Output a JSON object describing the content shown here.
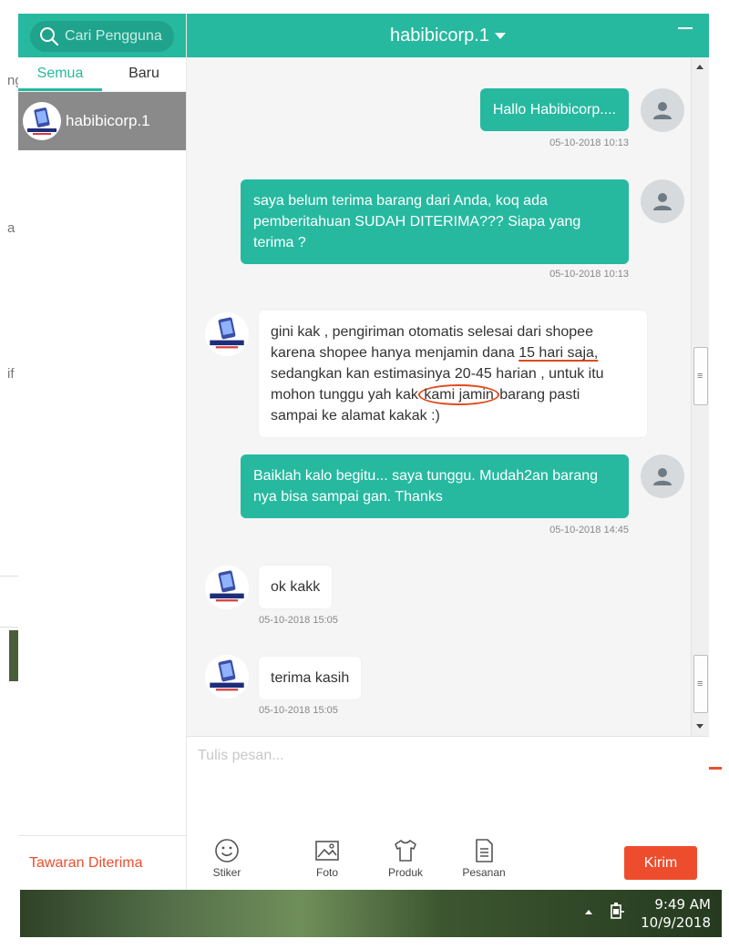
{
  "background_window": {
    "fragments": [
      "ng",
      "a",
      "if"
    ]
  },
  "sidebar": {
    "search_placeholder": "Cari Pengguna",
    "tabs": [
      {
        "label": "Semua",
        "active": true
      },
      {
        "label": "Baru",
        "active": false
      }
    ],
    "conversations": [
      {
        "name": "habibicorp.1",
        "avatar_text": "SMARTPHONE"
      }
    ],
    "footer_link": "Tawaran Diterima"
  },
  "chat": {
    "title": "habibicorp.1",
    "messages": [
      {
        "direction": "out",
        "text": "Hallo Habibicorp....",
        "time": "05-10-2018 10:13"
      },
      {
        "direction": "out",
        "text": "saya belum terima barang dari Anda, koq ada pemberitahuan SUDAH DITERIMA??? Siapa yang terima ?",
        "time": "05-10-2018 10:13"
      },
      {
        "direction": "in",
        "lines": [
          "gini kak , pengiriman otomatis selesai dari shopee",
          "karena shopee hanya menjamin dana ",
          "15 hari saja,",
          "sedangkan kan estimasinya 20-45 harian , untuk itu",
          "mohon tunggu yah kak ",
          "kami jamin",
          " barang pasti",
          "sampai ke alamat kakak :)"
        ],
        "time": ""
      },
      {
        "direction": "out",
        "text": "Baiklah kalo begitu... saya tunggu. Mudah2an barang nya bisa sampai gan. Thanks",
        "time": "05-10-2018 14:45"
      },
      {
        "direction": "in",
        "text": "ok kakk",
        "time": "05-10-2018 15:05"
      },
      {
        "direction": "in",
        "text": "terima kasih",
        "time": "05-10-2018 15:05"
      }
    ]
  },
  "composer": {
    "placeholder": "Tulis pesan...",
    "tools": [
      {
        "label": "Stiker",
        "icon": "smiley-icon"
      },
      {
        "label": "Foto",
        "icon": "image-icon"
      },
      {
        "label": "Produk",
        "icon": "shirt-icon"
      },
      {
        "label": "Pesanan",
        "icon": "document-icon"
      }
    ],
    "send_label": "Kirim"
  },
  "taskbar": {
    "time": "9:49 AM",
    "date": "10/9/2018"
  },
  "colors": {
    "accent": "#26b9a0",
    "accent_dark": "#1fa38d",
    "brand_orange": "#ee4d2d",
    "annotation": "#e04a1b"
  }
}
